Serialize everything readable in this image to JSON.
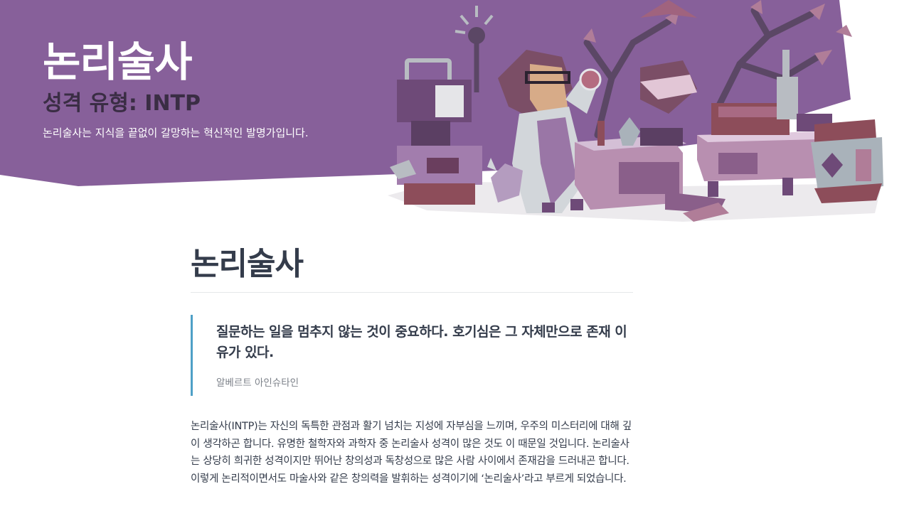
{
  "hero": {
    "title": "논리술사",
    "type_line": "성격 유형: INTP",
    "description": "논리술사는 지식을 끝없이 갈망하는 혁신적인 발명가입니다.",
    "bg_color": "#87609a",
    "illustration": "scientist-laboratory-illustration"
  },
  "article": {
    "title": "논리술사",
    "quote": {
      "text": "질문하는 일을 멈추지 않는 것이 중요하다. 호기심은 그 자체만으로 존재 이유가 있다.",
      "author": "알베르트 아인슈타인",
      "border_color": "#4fa0c7"
    },
    "intro": "논리술사(INTP)는 자신의 독특한 관점과 활기 넘치는 지성에 자부심을 느끼며, 우주의 미스터리에 대해 깊이 생각하곤 합니다. 유명한 철학자와 과학자 중 논리술사 성격이 많은 것도 이 때문일 것입니다. 논리술사는 상당히 희귀한 성격이지만 뛰어난 창의성과 독창성으로 많은 사람 사이에서 존재감을 드러내곤 합니다. 이렇게 논리적이면서도 마술사와 같은 창의력을 발휘하는 성격이기에 ‘논리술사’라고 부르게 되었습니다."
  }
}
